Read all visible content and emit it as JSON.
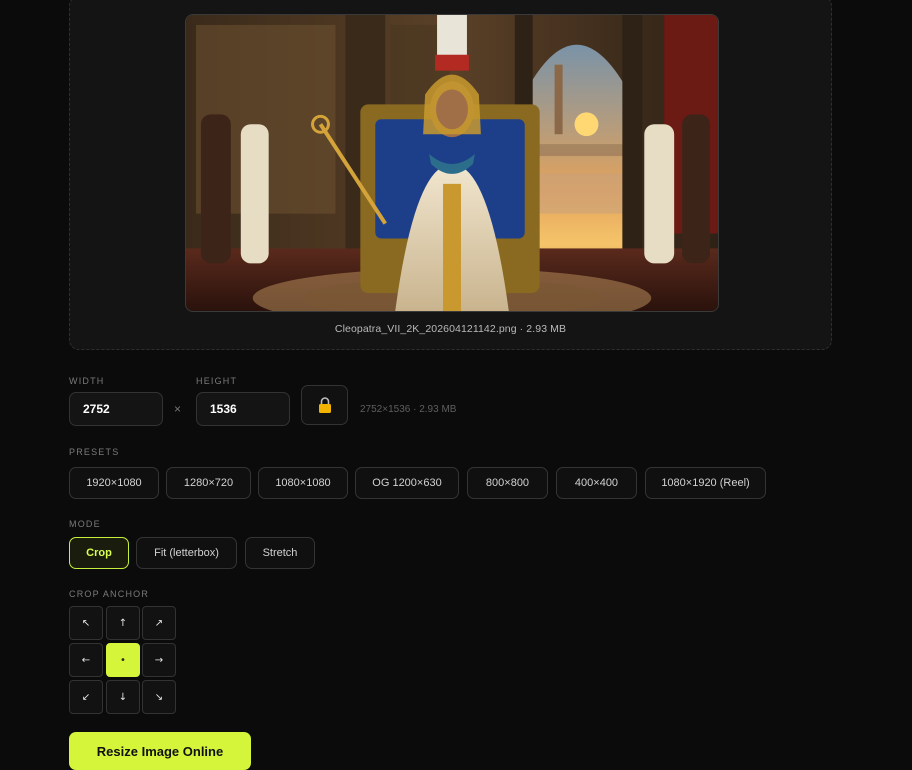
{
  "preview": {
    "filename": "Cleopatra_VII_2K_202604121142.png",
    "filesize": "2.93 MB",
    "separator": " · "
  },
  "dimensions": {
    "width_label": "WIDTH",
    "height_label": "HEIGHT",
    "width_value": "2752",
    "height_value": "1536",
    "times_glyph": "×",
    "lock_icon": "lock-icon",
    "meta": "2752×1536 · 2.93 MB"
  },
  "presets": {
    "label": "PRESETS",
    "items": [
      "1920×1080",
      "1280×720",
      "1080×1080",
      "OG 1200×630",
      "800×800",
      "400×400",
      "1080×1920 (Reel)"
    ]
  },
  "mode": {
    "label": "MODE",
    "items": [
      "Crop",
      "Fit (letterbox)",
      "Stretch"
    ],
    "selected": "Crop"
  },
  "crop_anchor": {
    "label": "CROP ANCHOR",
    "cells": [
      "↖",
      "↑",
      "↗",
      "←",
      "•",
      "→",
      "↙",
      "↓",
      "↘"
    ],
    "selected_index": 4
  },
  "action": {
    "label": "Resize Image Online"
  },
  "colors": {
    "accent": "#d4f53a",
    "background": "#0b0b0b",
    "panel": "#141414"
  }
}
